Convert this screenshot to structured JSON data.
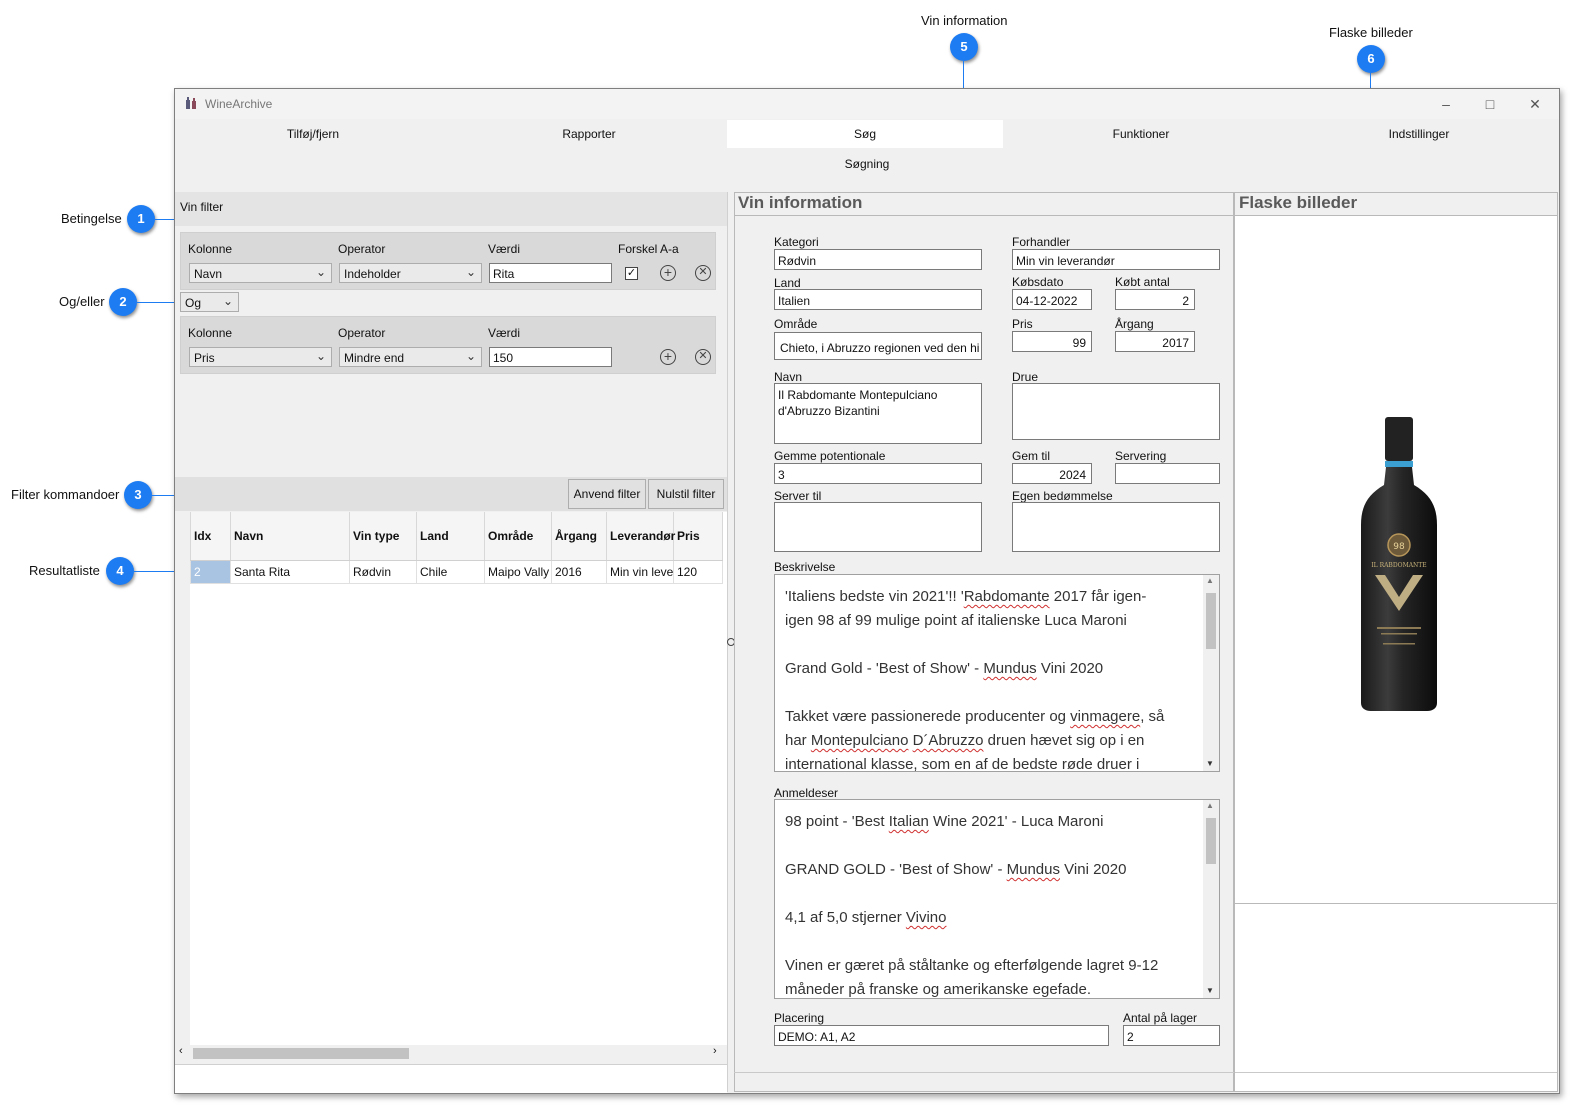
{
  "callouts": [
    {
      "num": "1",
      "label": "Betingelse"
    },
    {
      "num": "2",
      "label": "Og/eller"
    },
    {
      "num": "3",
      "label": "Filter kommandoer"
    },
    {
      "num": "4",
      "label": "Resultatliste"
    },
    {
      "num": "5",
      "label": "Vin information"
    },
    {
      "num": "6",
      "label": "Flaske billeder"
    }
  ],
  "window": {
    "title": "WineArchive"
  },
  "tabs": [
    "Tilføj/fjern",
    "Rapporter",
    "Søg",
    "Funktioner",
    "Indstillinger"
  ],
  "active_tab": "Søg",
  "subtab": "Søgning",
  "filter": {
    "header": "Vin filter",
    "cond1": {
      "kolonne_label": "Kolonne",
      "operator_label": "Operator",
      "vaerdi_label": "Værdi",
      "forskel_label": "Forskel A-a",
      "kolonne": "Navn",
      "operator": "Indeholder",
      "vaerdi": "Rita",
      "forskel_checked": "✓"
    },
    "andor": "Og",
    "cond2": {
      "kolonne_label": "Kolonne",
      "operator_label": "Operator",
      "vaerdi_label": "Værdi",
      "kolonne": "Pris",
      "operator": "Mindre end",
      "vaerdi": "150"
    },
    "apply_label": "Anvend filter",
    "reset_label": "Nulstil filter"
  },
  "results": {
    "columns": [
      "Idx",
      "Navn",
      "Vin type",
      "Land",
      "Område",
      "Årgang",
      "Leverandør",
      "Pris"
    ],
    "rows": [
      [
        "2",
        "Santa Rita",
        "Rødvin",
        "Chile",
        "Maipo Vally",
        "2016",
        "Min vin leve",
        "120"
      ]
    ]
  },
  "vin_info": {
    "title": "Vin information",
    "kategori_label": "Kategori",
    "kategori": "Rødvin",
    "forhandler_label": "Forhandler",
    "forhandler": "Min vin leverandør",
    "land_label": "Land",
    "land": "Italien",
    "kobsdato_label": "Købsdato",
    "kobsdato": "04-12-2022",
    "kobt_antal_label": "Købt antal",
    "kobt_antal": "2",
    "omrade_label": "Område",
    "omrade": "Chieto, i Abruzzo regionen ved den hi",
    "pris_label": "Pris",
    "pris": "99",
    "argang_label": "Årgang",
    "argang": "2017",
    "navn_label": "Navn",
    "navn": "Il Rabdomante Montepulciano\nd'Abruzzo Bizantini",
    "drue_label": "Drue",
    "drue": "",
    "gemme_label": "Gemme potentionale",
    "gemme": "3",
    "gem_til_label": "Gem til",
    "gem_til": "2024",
    "servering_label": "Servering",
    "servering": "",
    "server_til_label": "Server til",
    "server_til": "",
    "egen_label": "Egen bedømmelse",
    "egen": "",
    "beskrivelse_label": "Beskrivelse",
    "beskrivelse": [
      "'Italiens bedste vin 2021'!! 'Rabdomante 2017 får igen-",
      "igen 98 af 99 mulige point af italienske Luca Maroni",
      "",
      "Grand Gold - 'Best of Show' - Mundus Vini 2020",
      "",
      "Takket være passionerede producenter og vinmagere, så",
      "har Montepulciano D´Abruzzo druen hævet sig op i en",
      "international klasse, som en af de bedste røde druer i"
    ],
    "anmeldelser_label": "Anmeldeser",
    "anmeldelser": [
      "98 point - 'Best Italian Wine 2021' - Luca Maroni",
      "",
      "GRAND GOLD - 'Best of Show' - Mundus Vini 2020",
      "",
      "4,1 af 5,0 stjerner Vivino",
      "",
      "Vinen er gæret på ståltanke og efterfølgende lagret 9-12",
      "måneder på franske og amerikanske egefade."
    ],
    "placering_label": "Placering",
    "placering": "DEMO: A1, A2",
    "antal_label": "Antal på lager",
    "antal": "2"
  },
  "bottle": {
    "title": "Flaske billeder",
    "label_text": "IL RABDOMANTE"
  }
}
